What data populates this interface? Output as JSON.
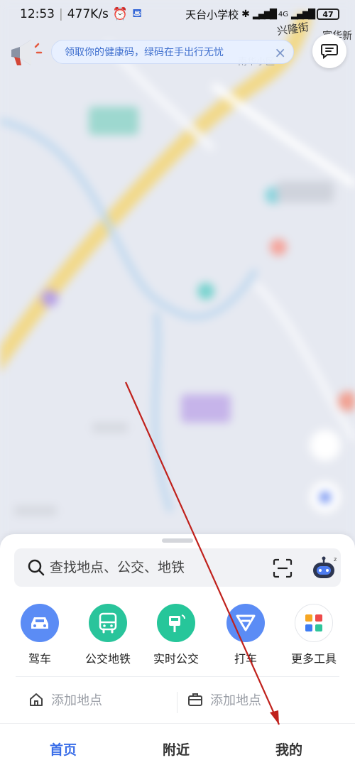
{
  "status_bar": {
    "time": "12:53",
    "speed": "477K/s",
    "network": "4G",
    "battery": "47"
  },
  "map": {
    "labels": [
      "天台小学校",
      "兴隆街",
      "富华新",
      "南华小区"
    ]
  },
  "banner": {
    "text": "领取你的健康码，绿码在手出行无忧",
    "close_icon": "×"
  },
  "search": {
    "placeholder": "查找地点、公交、地铁"
  },
  "tools": [
    {
      "label": "驾车",
      "icon": "car-icon",
      "color": "#5b8cf5"
    },
    {
      "label": "公交地铁",
      "icon": "bus-icon",
      "color": "#29c49b"
    },
    {
      "label": "实时公交",
      "icon": "bus-stop-icon",
      "color": "#26c69a"
    },
    {
      "label": "打车",
      "icon": "taxi-icon",
      "color": "#5b8cf5"
    },
    {
      "label": "更多工具",
      "icon": "apps-icon",
      "color": "#ffffff"
    }
  ],
  "places": [
    {
      "label": "添加地点",
      "icon": "home-icon"
    },
    {
      "label": "添加地点",
      "icon": "briefcase-icon"
    }
  ],
  "nav": {
    "items": [
      {
        "label": "首页",
        "active": true
      },
      {
        "label": "附近",
        "active": false
      },
      {
        "label": "我的",
        "active": false
      }
    ]
  },
  "colors": {
    "accent": "#3a6ee8",
    "annotation": "#c0211c"
  }
}
